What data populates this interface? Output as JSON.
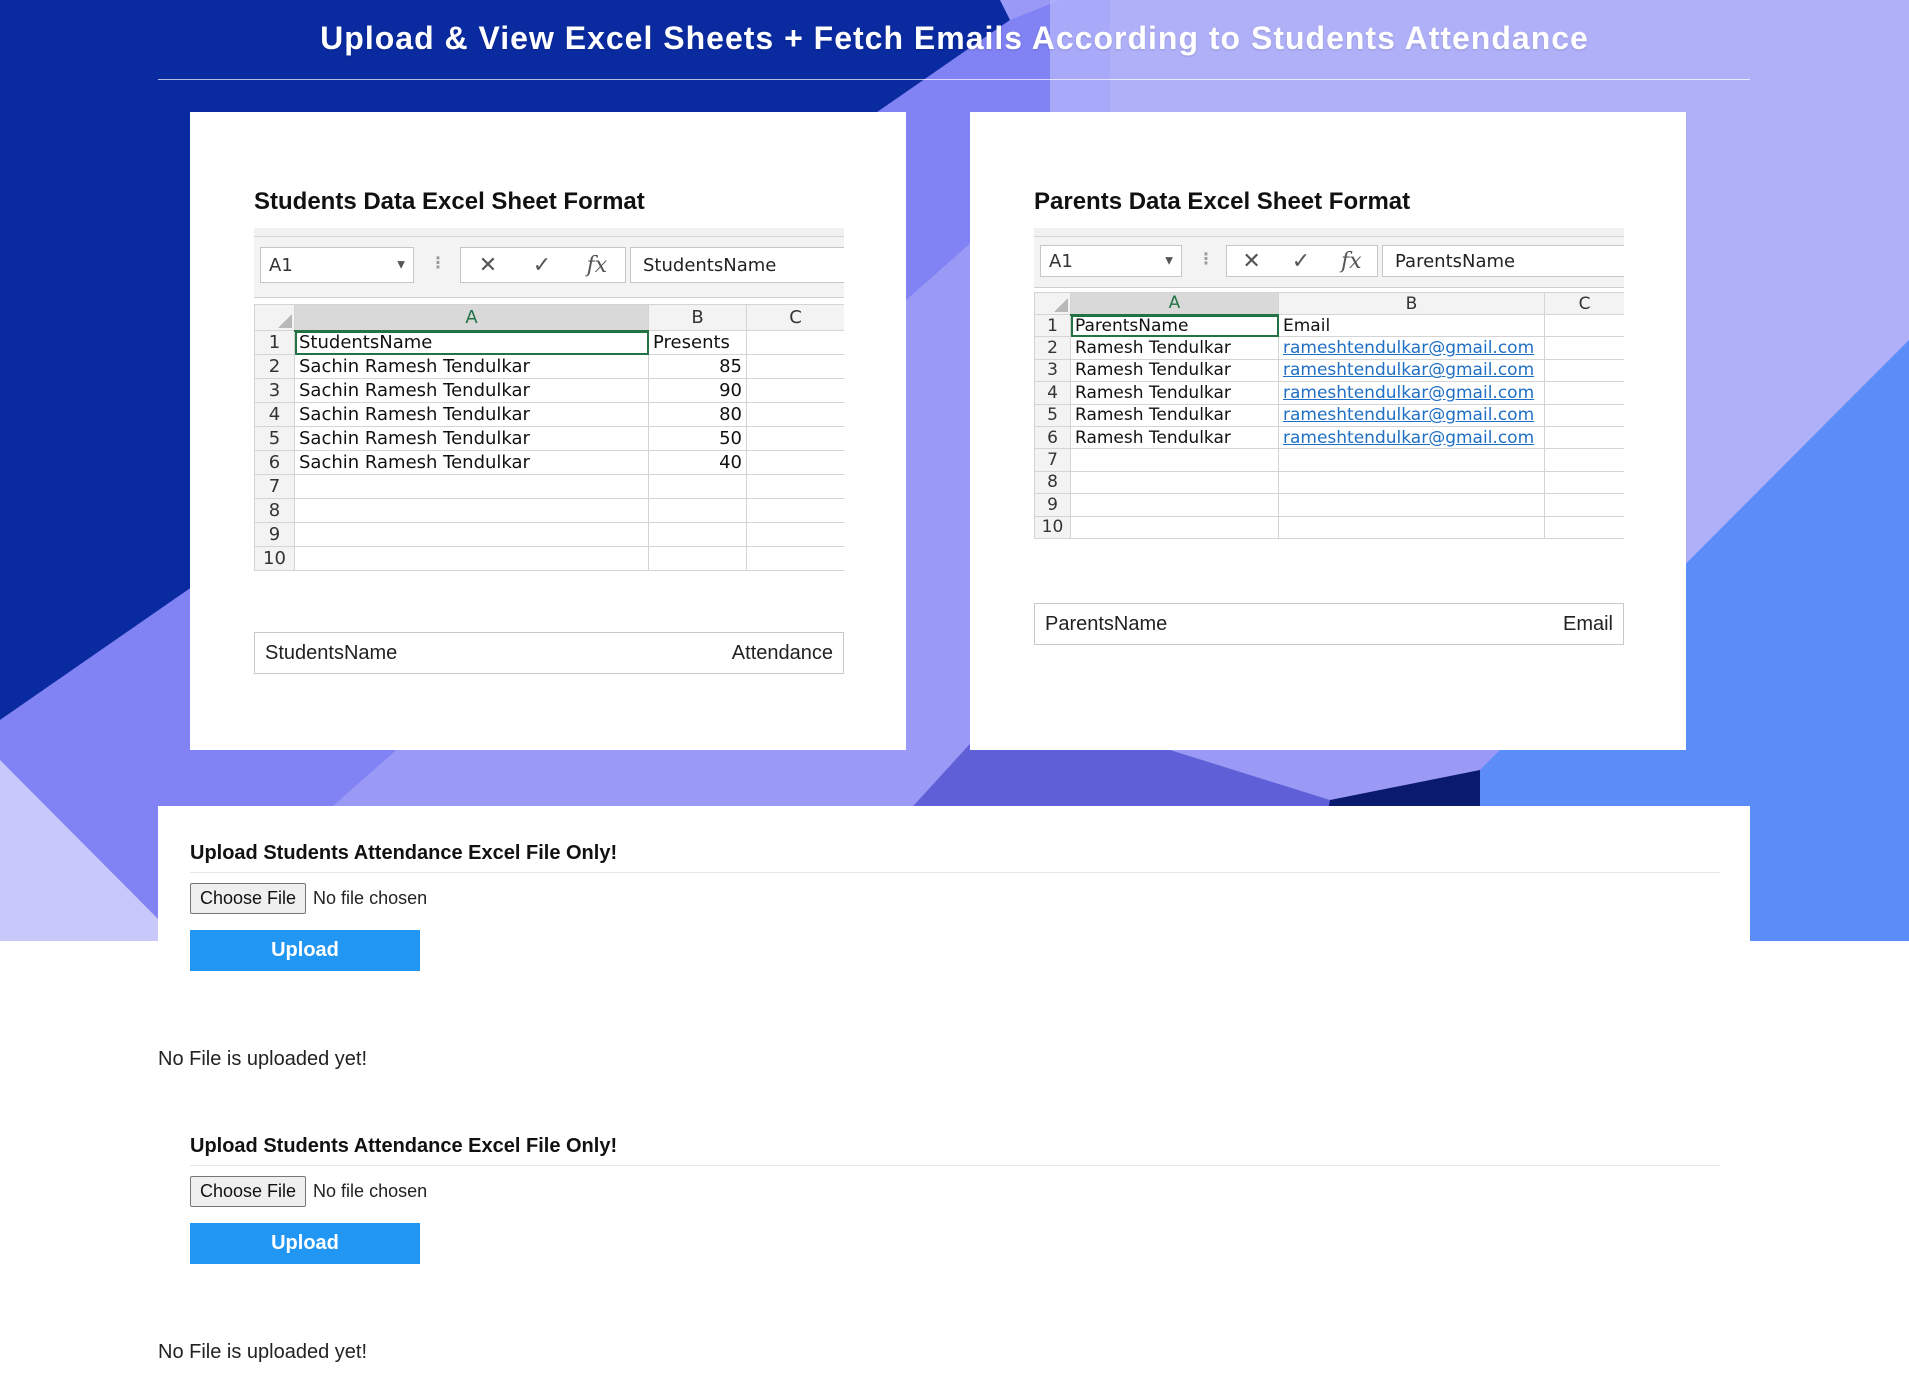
{
  "page": {
    "title": "Upload & View Excel Sheets + Fetch Emails According to Students Attendance"
  },
  "students_card": {
    "heading": "Students Data Excel Sheet Format",
    "namebox": "A1",
    "formula": "StudentsName",
    "columns": [
      "A",
      "B",
      "C"
    ],
    "rows": [
      {
        "n": "1",
        "a": "StudentsName",
        "b": "Presents",
        "c": ""
      },
      {
        "n": "2",
        "a": "Sachin Ramesh Tendulkar",
        "b": "85",
        "c": ""
      },
      {
        "n": "3",
        "a": "Sachin Ramesh Tendulkar",
        "b": "90",
        "c": ""
      },
      {
        "n": "4",
        "a": "Sachin Ramesh Tendulkar",
        "b": "80",
        "c": ""
      },
      {
        "n": "5",
        "a": "Sachin Ramesh Tendulkar",
        "b": "50",
        "c": ""
      },
      {
        "n": "6",
        "a": "Sachin Ramesh Tendulkar",
        "b": "40",
        "c": ""
      },
      {
        "n": "7",
        "a": "",
        "b": "",
        "c": ""
      },
      {
        "n": "8",
        "a": "",
        "b": "",
        "c": ""
      },
      {
        "n": "9",
        "a": "",
        "b": "",
        "c": ""
      },
      {
        "n": "10",
        "a": "",
        "b": "",
        "c": ""
      }
    ],
    "caption_left": "StudentsName",
    "caption_right": "Attendance"
  },
  "parents_card": {
    "heading": "Parents Data Excel Sheet Format",
    "namebox": "A1",
    "formula": "ParentsName",
    "columns": [
      "A",
      "B",
      "C"
    ],
    "rows": [
      {
        "n": "1",
        "a": "ParentsName",
        "b": "Email",
        "c": ""
      },
      {
        "n": "2",
        "a": "Ramesh Tendulkar",
        "b": "rameshtendulkar@gmail.com",
        "c": ""
      },
      {
        "n": "3",
        "a": "Ramesh Tendulkar",
        "b": "rameshtendulkar@gmail.com",
        "c": ""
      },
      {
        "n": "4",
        "a": "Ramesh Tendulkar",
        "b": "rameshtendulkar@gmail.com",
        "c": ""
      },
      {
        "n": "5",
        "a": "Ramesh Tendulkar",
        "b": "rameshtendulkar@gmail.com",
        "c": ""
      },
      {
        "n": "6",
        "a": "Ramesh Tendulkar",
        "b": "rameshtendulkar@gmail.com",
        "c": ""
      },
      {
        "n": "7",
        "a": "",
        "b": "",
        "c": ""
      },
      {
        "n": "8",
        "a": "",
        "b": "",
        "c": ""
      },
      {
        "n": "9",
        "a": "",
        "b": "",
        "c": ""
      },
      {
        "n": "10",
        "a": "",
        "b": "",
        "c": ""
      }
    ],
    "caption_left": "ParentsName",
    "caption_right": "Email"
  },
  "upload_sections": [
    {
      "heading": "Upload Students Attendance Excel File Only!",
      "choose_label": "Choose File",
      "file_status": "No file chosen",
      "upload_label": "Upload",
      "result": "No File is uploaded yet!"
    },
    {
      "heading": "Upload Students Attendance Excel File Only!",
      "choose_label": "Choose File",
      "file_status": "No file chosen",
      "upload_label": "Upload",
      "result": "No File is uploaded yet!"
    }
  ],
  "colors": {
    "accent": "#2196f3",
    "excel_green": "#217346",
    "hero_lavender": "#9a9af6",
    "hero_navy": "#0a2aa0"
  }
}
